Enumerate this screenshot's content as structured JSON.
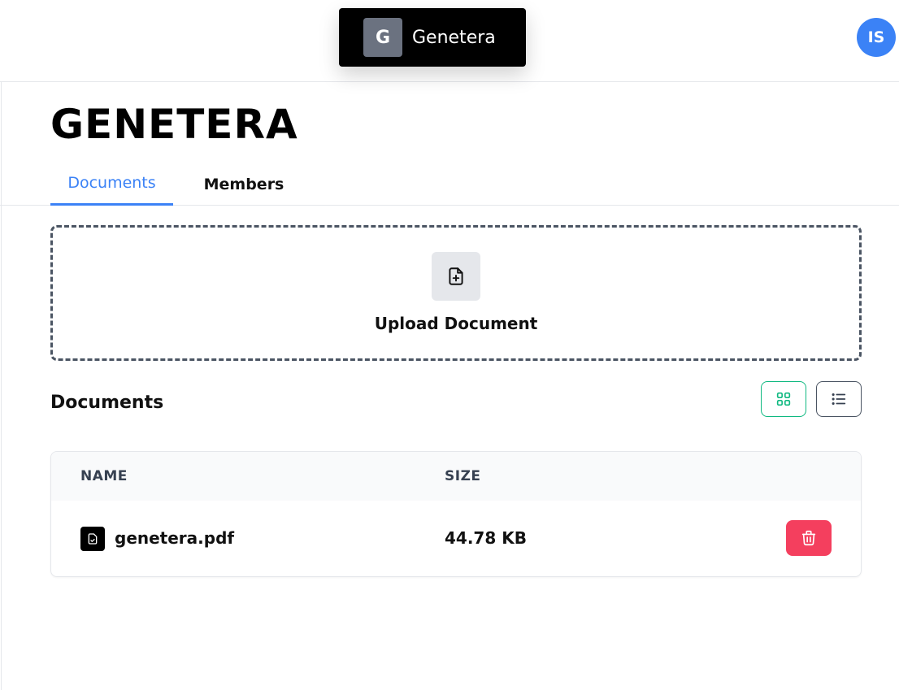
{
  "topbar": {
    "workspace": {
      "initial": "G",
      "name": "Genetera"
    },
    "user_initials": "IS"
  },
  "page": {
    "title": "GENETERA"
  },
  "tabs": [
    {
      "label": "Documents",
      "active": true
    },
    {
      "label": "Members",
      "active": false
    }
  ],
  "upload": {
    "label": "Upload Document",
    "icon": "file-plus-icon"
  },
  "documents": {
    "section_title": "Documents",
    "view_toggle": {
      "grid_icon": "grid-icon",
      "list_icon": "list-icon",
      "selected": "grid"
    },
    "columns": {
      "name": "NAME",
      "size": "SIZE"
    },
    "rows": [
      {
        "name": "genetera.pdf",
        "size": "44.78 KB",
        "icon": "file-pdf-icon",
        "action_icon": "trash-icon"
      }
    ]
  },
  "colors": {
    "accent": "#3b82f6",
    "grid_toggle_border": "#10b981",
    "delete": "#f43f5e",
    "workspace_bg": "#000000"
  }
}
